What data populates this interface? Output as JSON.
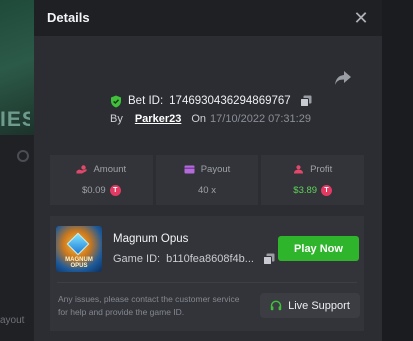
{
  "background": {
    "hero_text": "IES",
    "side_text": "ayout"
  },
  "modal": {
    "title": "Details",
    "close_glyph": "✕",
    "bet_id_label": "Bet ID:",
    "bet_id": "1746930436294869767",
    "by_label": "By",
    "username": "Parker23",
    "on_label": "On",
    "date": "17/10/2022 07:31:29",
    "stats": [
      {
        "label": "Amount",
        "value": "$0.09",
        "icon": "hand-coins-icon",
        "icon_color": "#e2486b",
        "coin": true,
        "value_color": "#9ea1a8"
      },
      {
        "label": "Payout",
        "value": "40 x",
        "icon": "wallet-icon",
        "icon_color": "#b46bd9",
        "coin": false,
        "value_color": "#9ea1a8"
      },
      {
        "label": "Profit",
        "value": "$3.89",
        "icon": "user-profit-icon",
        "icon_color": "#e2486b",
        "coin": true,
        "value_color": "#5fd35a"
      }
    ],
    "coin_glyph": "T",
    "game": {
      "name": "Magnum Opus",
      "id_label": "Game ID:",
      "id_value": "b110fea8608f4b...",
      "thumb_text": "MAGNUM OPUS",
      "play_label": "Play Now",
      "issue_text": "Any issues, please contact the customer service for help and provide the game ID.",
      "support_label": "Live Support"
    }
  },
  "colors": {
    "accent_green": "#2fb52b",
    "profit_green": "#5fd35a",
    "coin_red": "#e23a63"
  }
}
